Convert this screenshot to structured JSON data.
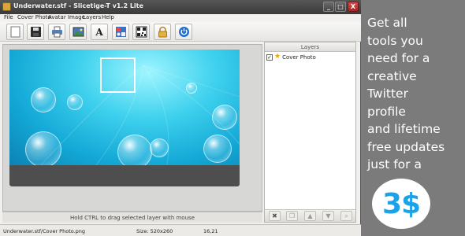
{
  "window": {
    "title": "Underwater.stf - Slicetige-T v1.2 Lite",
    "controls": {
      "minimize": "_",
      "maximize": "□",
      "close": "X"
    }
  },
  "menu": [
    "File",
    "Cover Photo",
    "Avatar Image",
    "Layers",
    "Help"
  ],
  "toolbar": {
    "buttons": [
      "new-document-icon",
      "save-icon",
      "print-icon",
      "image-icon",
      "text-icon",
      "contact-icon",
      "qr-code-icon",
      "lock-icon",
      "power-icon"
    ],
    "text_button_label": "A"
  },
  "canvas": {
    "hint": "Hold CTRL to drag selected layer with mouse"
  },
  "layers": {
    "header": "Layers",
    "items": [
      {
        "name": "Cover Photo",
        "checked": true,
        "checkmark": "✓"
      }
    ],
    "actions": [
      "delete-icon",
      "duplicate-icon",
      "move-up-icon",
      "move-down-icon",
      "zoom-icon"
    ],
    "delete_glyph": "✖"
  },
  "status": {
    "file": "Underwater.stf/Cover Photo.png",
    "size": "Size: 520x260",
    "coords": "16,21"
  },
  "promo": {
    "lines": [
      "Get all",
      "tools you",
      "need for a",
      "creative",
      "Twitter",
      "profile",
      "and lifetime",
      "free updates",
      "just for  a"
    ],
    "price": "3$"
  },
  "colors": {
    "price": "#1aa2ea",
    "promo_background": "#7b7b7b",
    "title_bar": "#474747"
  }
}
